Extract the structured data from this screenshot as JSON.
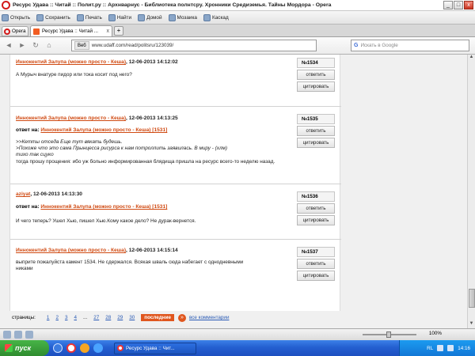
{
  "window": {
    "title": "Ресурс Удава :: Читай :: Полит.ру :: Архнварнус - Библиотека полнтсру. Хронники Средиземья. Тайны Мордора - Opera",
    "minimize": "_",
    "maximize": "□",
    "close": "x"
  },
  "menubar": {
    "items": [
      "Открыть",
      "Сохранить",
      "Печать",
      "Найти",
      "Домой",
      "Мозаика",
      "Каскад"
    ]
  },
  "tabs": {
    "opera_label": "Opera",
    "active_tab": "Ресурс Удава :: Читай ...",
    "close": "x",
    "new_tab": "+"
  },
  "address": {
    "back": "◄",
    "forward": "►",
    "reload": "↻",
    "home": "⌂",
    "web_badge": "Веб",
    "url": "www.udaff.com/read/politsru/123039/",
    "search_engine": "G",
    "search_placeholder": "Искать в Google"
  },
  "comments": [
    {
      "author": "Иннокентий Залупа (можно просто - Кеша)",
      "date": ", 12-06-2013 14:12:02",
      "reply_prefix": "",
      "reply_to": "",
      "text_lines": [
        "А Мурыч внатуре пидор или тока косит под него?"
      ],
      "number": "№1534",
      "reply_button": "ответить",
      "quote_button": "цитировать"
    },
    {
      "author": "Иннокентий Залупа (можно просто - Кеша)",
      "date": ", 12-06-2013 14:13:25",
      "reply_prefix": "ответ на: ",
      "reply_to": "Иннокентий Залупа (можно просто - Кеша) [1531]",
      "quote_lines": [
        ">>Кетты отседа Еще тут вякать будешь.",
        ">Похоже что это сама Прынцесса рисурса к нам потроллить заявилась.  В миру    - (хлм)",
        "тихо так сцуко"
      ],
      "text_lines": [
        "тогда прошу прощения: ибо уж больно информированная блядища пришла на ресурс всего-то неделю назад."
      ],
      "number": "№1535",
      "reply_button": "ответить",
      "quote_button": "цитировать"
    },
    {
      "author": "aziyat",
      "date": ", 12-06-2013 14:13:30",
      "reply_prefix": "ответ на: ",
      "reply_to": "Иннокентий Залупа (можно просто - Кеша) [1531]",
      "text_lines": [
        "И чего теперь? Ушел Хью, пишел Хью.Кому какое дело? Не дурак-вернется."
      ],
      "number": "№1536",
      "reply_button": "ответить",
      "quote_button": "цитировать"
    },
    {
      "author": "Иннокентий Залупа (можно просто - Кеша)",
      "date": ", 12-06-2013 14:15:14",
      "reply_prefix": "",
      "reply_to": "",
      "text_lines": [
        "выприте пожалуйста камент 1534. Не сдержался. Всякая шваль сюда набегает с однодневными",
        "никами"
      ],
      "number": "№1537",
      "reply_button": "ответить",
      "quote_button": "цитировать"
    }
  ],
  "pager": {
    "label": "страницы:",
    "pages": [
      "1",
      "2",
      "3",
      "4",
      "...",
      "27",
      "28",
      "29",
      "30"
    ],
    "last_label": "последние",
    "arrow": "»",
    "all_comments": "все комментарии"
  },
  "statusbar": {
    "zoom": "100%"
  },
  "taskbar": {
    "start": "пуск",
    "task_item": "Ресурс Удава :: Чит...",
    "lang": "RL",
    "time": "14:16"
  },
  "colors": {
    "accent": "#e0561e",
    "link_orange": "#d04a12",
    "link_blue": "#2a5bb5"
  }
}
